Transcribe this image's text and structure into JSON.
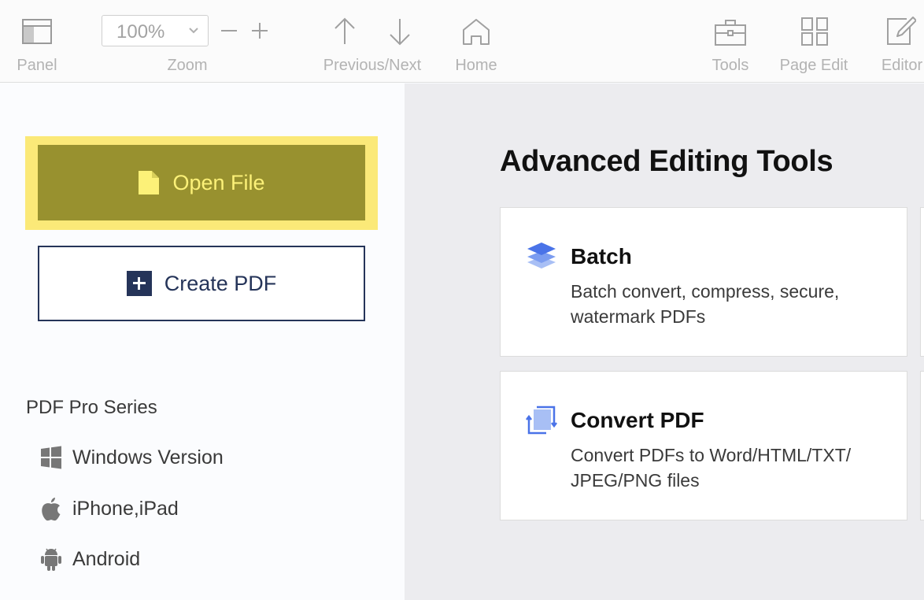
{
  "toolbar": {
    "panel_label": "Panel",
    "zoom_label": "Zoom",
    "zoom_value": "100%",
    "prev_next_label": "Previous/Next",
    "home_label": "Home",
    "tools_label": "Tools",
    "page_edit_label": "Page Edit",
    "editor_label": "Editor"
  },
  "sidebar": {
    "open_file_label": "Open File",
    "create_pdf_label": "Create PDF",
    "series_title": "PDF Pro Series",
    "series_items": [
      {
        "label": "Windows Version",
        "icon": "windows-icon"
      },
      {
        "label": "iPhone,iPad",
        "icon": "apple-icon"
      },
      {
        "label": "Android",
        "icon": "android-icon"
      }
    ]
  },
  "main": {
    "section_title": "Advanced Editing Tools",
    "cards": [
      {
        "title": "Batch",
        "description": "Batch convert, compress, secure, watermark PDFs",
        "icon": "layers-icon"
      },
      {
        "title": "Convert PDF",
        "description": "Convert PDFs to Word/HTML/TXT/ JPEG/PNG files",
        "icon": "convert-icon"
      }
    ]
  },
  "colors": {
    "highlight": "#fbe978",
    "open_button": "#98912f",
    "open_text": "#fcf178",
    "navy": "#253459",
    "accent_blue": "#4a73e8"
  }
}
